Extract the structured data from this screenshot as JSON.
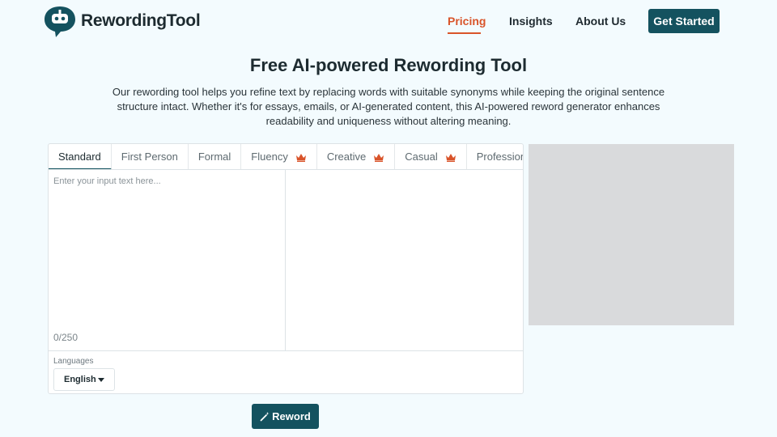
{
  "brand": {
    "name": "RewordingTool",
    "accent": "#d9542a",
    "primary": "#14525f"
  },
  "nav": {
    "items": [
      {
        "label": "Pricing",
        "active": true
      },
      {
        "label": "Insights",
        "active": false
      },
      {
        "label": "About Us",
        "active": false
      }
    ],
    "cta_label": "Get Started"
  },
  "hero": {
    "title": "Free AI-powered Rewording Tool",
    "description": "Our rewording tool helps you refine text by replacing words with suitable synonyms while keeping the original sentence structure intact. Whether it's for essays, emails, or AI-generated content, this AI-powered reword generator enhances readability and uniqueness without altering meaning."
  },
  "tool": {
    "tabs": [
      {
        "label": "Standard",
        "active": true,
        "premium": false
      },
      {
        "label": "First Person",
        "active": false,
        "premium": false
      },
      {
        "label": "Formal",
        "active": false,
        "premium": false
      },
      {
        "label": "Fluency",
        "active": false,
        "premium": true
      },
      {
        "label": "Creative",
        "active": false,
        "premium": true
      },
      {
        "label": "Casual",
        "active": false,
        "premium": true
      },
      {
        "label": "Professional",
        "active": false,
        "premium": true
      }
    ],
    "input_placeholder": "Enter your input text here...",
    "input_value": "",
    "counter": "0/250",
    "languages_label": "Languages",
    "language_selected": "English",
    "submit_label": "Reword"
  }
}
